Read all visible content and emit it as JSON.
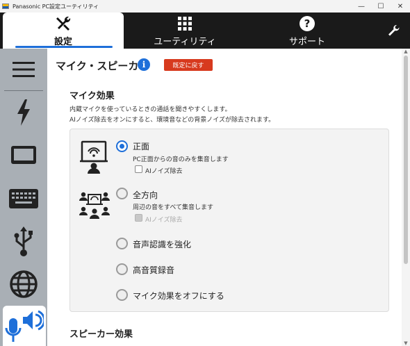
{
  "window": {
    "title": "Panasonic PC設定ユーティリティ",
    "minimize": "—",
    "maximize": "☐",
    "close": "✕"
  },
  "topnav": {
    "tabs": [
      {
        "label": "設定",
        "icon": "tools-icon",
        "active": true
      },
      {
        "label": "ユーティリティ",
        "icon": "grid-icon",
        "active": false
      },
      {
        "label": "サポート",
        "icon": "help-icon",
        "active": false
      }
    ],
    "wrench_icon": "wrench-icon"
  },
  "sidebar": {
    "items": [
      {
        "icon": "menu-icon"
      },
      {
        "icon": "power-icon"
      },
      {
        "icon": "display-icon"
      },
      {
        "icon": "keyboard-icon"
      },
      {
        "icon": "usb-icon"
      },
      {
        "icon": "globe-icon"
      },
      {
        "icon": "mic-speaker-icon",
        "active": true
      }
    ]
  },
  "main": {
    "title": "マイク・スピーカー",
    "info_icon_glyph": "i",
    "reset_label": "既定に戻す",
    "mic_section": {
      "title": "マイク効果",
      "desc_line1": "内蔵マイクを使っているときの通話を聞きやすくします。",
      "desc_line2": "AIノイズ除去をオンにすると、環境音などの背景ノイズが除去されます。",
      "options": [
        {
          "label": "正面",
          "desc": "PC正面からの音のみを集音します",
          "checkbox": "AIノイズ除去",
          "checked": true,
          "checkbox_enabled": true
        },
        {
          "label": "全方向",
          "desc": "周辺の音をすべて集音します",
          "checkbox": "AIノイズ除去",
          "checked": false,
          "checkbox_enabled": false
        },
        {
          "label": "音声認識を強化",
          "checked": false
        },
        {
          "label": "高音質録音",
          "checked": false
        },
        {
          "label": "マイク効果をオフにする",
          "checked": false
        }
      ]
    },
    "speaker_section": {
      "title": "スピーカー効果"
    }
  },
  "colors": {
    "accent": "#1e6fd9",
    "reset_button": "#d73a1e",
    "topnav_bg": "#1a1a1a",
    "sidebar_bg": "#a9afb5"
  }
}
